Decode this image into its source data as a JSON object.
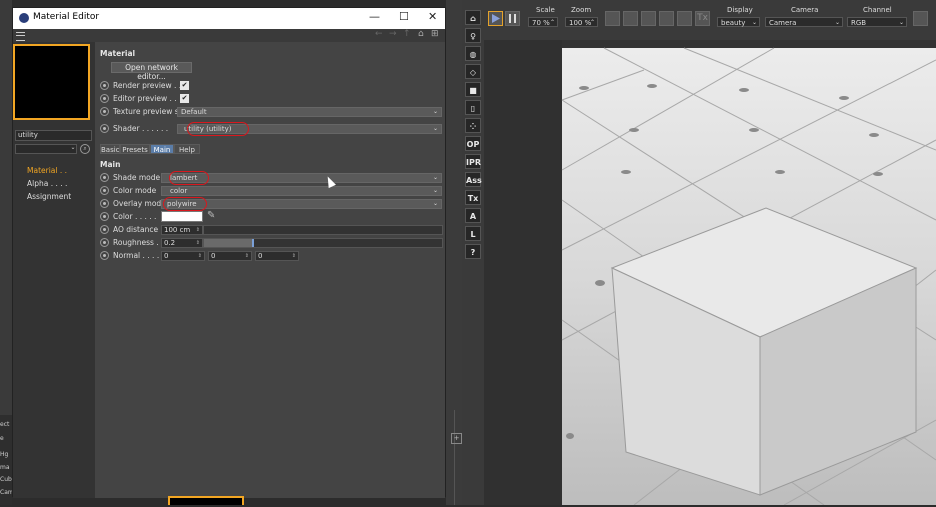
{
  "background_app": {
    "left_texts": [
      "ect",
      "e",
      "Hg",
      "ma",
      "Cub",
      "Cam"
    ],
    "render_toolbar": {
      "scale_label": "Scale",
      "scale_value": "70 %",
      "zoom_label": "Zoom",
      "zoom_value": "100 %",
      "tx_label": "Tx",
      "display_label": "Display",
      "display_value": "beauty",
      "camera_label": "Camera",
      "camera_value": "Camera",
      "channel_label": "Channel",
      "channel_value": "RGB"
    },
    "vertical_toolbar": [
      "OP",
      "IPR",
      "Ass",
      "Tx",
      "L",
      "?"
    ]
  },
  "window": {
    "title": "Material Editor",
    "minimize": "—",
    "maximize": "☐",
    "close": "✕"
  },
  "left_pane": {
    "search_value": "utility",
    "channels": [
      {
        "label": "Material . .",
        "active": true
      },
      {
        "label": "Alpha . . . .",
        "active": false
      },
      {
        "label": "Assignment",
        "active": false
      }
    ]
  },
  "material": {
    "section_title": "Material",
    "open_network_editor": "Open network editor...",
    "render_preview_label": "Render preview . .",
    "render_preview_checked": true,
    "editor_preview_label": "Editor preview . .",
    "editor_preview_checked": true,
    "texture_preview_size_label": "Texture preview size",
    "texture_preview_size_value": "Default",
    "shader_label": "Shader . . . . . .",
    "shader_value": "utility (utility)"
  },
  "tabs": [
    {
      "label": "Basic",
      "active": false
    },
    {
      "label": "Presets",
      "active": false
    },
    {
      "label": "Main",
      "active": true
    },
    {
      "label": "Help",
      "active": false
    }
  ],
  "main": {
    "section_title": "Main",
    "shade_mode_label": "Shade mode",
    "shade_mode_value": "lambert",
    "color_mode_label": "Color mode",
    "color_mode_value": "color",
    "overlay_mode_label": "Overlay mode",
    "overlay_mode_value": "polywire",
    "color_label": "Color . . . . .",
    "color_swatch": "#ffffff",
    "ao_distance_label": "AO distance",
    "ao_distance_value": "100 cm",
    "roughness_label": "Roughness . .",
    "roughness_value": "0.2",
    "roughness_fraction": 0.2,
    "normal_label": "Normal . . . .",
    "normal_values": [
      "0",
      "0",
      "0"
    ]
  },
  "colors": {
    "accent_orange": "#f2a623",
    "highlight_red": "#d9181e",
    "tab_active": "#5b7da8"
  }
}
